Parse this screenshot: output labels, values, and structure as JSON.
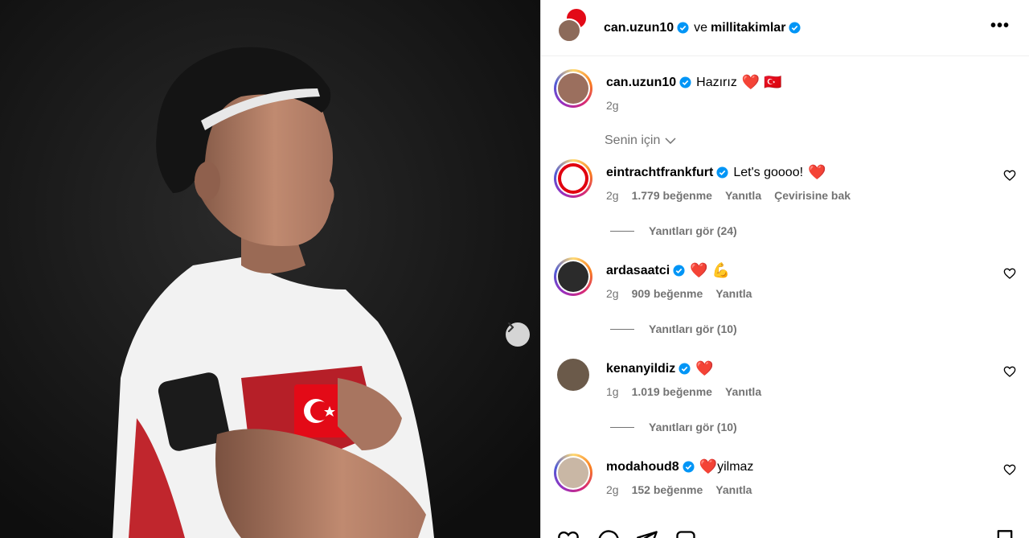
{
  "header": {
    "author": "can.uzun10",
    "conjunction": "ve",
    "coauthor": "millitakimlar"
  },
  "caption": {
    "user": "can.uzun10",
    "text": "Hazırız",
    "emoji": "❤️ 🇹🇷",
    "time": "2g"
  },
  "for_you_label": "Senin için",
  "comments": [
    {
      "user": "eintrachtfrankfurt",
      "text": "Let's goooo!",
      "emoji": "❤️",
      "time": "2g",
      "likes": "1.779 beğenme",
      "reply": "Yanıtla",
      "translate": "Çevirisine bak",
      "view_replies": "Yanıtları gör (24)"
    },
    {
      "user": "ardasaatci",
      "text": "",
      "emoji": "❤️ 💪",
      "time": "2g",
      "likes": "909 beğenme",
      "reply": "Yanıtla",
      "view_replies": "Yanıtları gör (10)"
    },
    {
      "user": "kenanyildiz",
      "text": "",
      "emoji": "❤️",
      "time": "1g",
      "likes": "1.019 beğenme",
      "reply": "Yanıtla",
      "view_replies": "Yanıtları gör (10)"
    },
    {
      "user": "modahoud8",
      "text": "yilmaz",
      "emoji": "❤️",
      "time": "2g",
      "likes": "152 beğenme",
      "reply": "Yanıtla"
    }
  ],
  "colors": {
    "verified": "#0095f6",
    "secondary_text": "#737373",
    "heart": "#ed1c2e",
    "turkey_red": "#e30a17"
  },
  "icons": [
    "more-options-icon",
    "verified-icon",
    "chevron-down-icon",
    "heart-outline-icon",
    "next-arrow-icon",
    "comment-icon",
    "share-icon",
    "save-icon"
  ]
}
